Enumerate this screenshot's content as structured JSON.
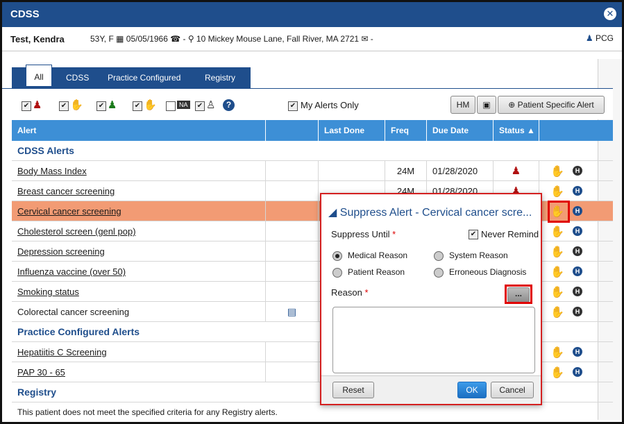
{
  "window": {
    "title": "CDSS",
    "close_glyph": "✕"
  },
  "patient": {
    "name": "Test, Kendra",
    "info": "53Y, F  ▦ 05/05/1966  ☎ -  ⚲ 10 Mickey Mouse Lane, Fall River, MA 2721  ✉ -",
    "pcg": "PCG"
  },
  "tabs": [
    {
      "label": "All",
      "active": true
    },
    {
      "label": "CDSS",
      "active": false
    },
    {
      "label": "Practice Configured",
      "active": false
    },
    {
      "label": "Registry",
      "active": false
    }
  ],
  "toolbar": {
    "my_alerts_only": "My Alerts Only",
    "hm_label": "HM",
    "patient_specific_alert": "Patient Specific Alert",
    "na_label": "NA"
  },
  "table": {
    "headers": [
      "Alert",
      "",
      "Last Done",
      "Freq",
      "Due Date",
      "Status ▲",
      ""
    ],
    "sections": {
      "cdss": "CDSS Alerts",
      "practice": "Practice Configured Alerts",
      "registry": "Registry"
    },
    "rows": [
      {
        "name": "Body Mass Index",
        "freq": "24M",
        "due": "01/28/2020",
        "status_icon": "person-alert-icon"
      },
      {
        "name": "Breast cancer screening",
        "freq": "24M",
        "due": "01/28/2020",
        "status_icon": "person-alert-icon"
      },
      {
        "name": "Cervical cancer screening"
      },
      {
        "name": "Cholesterol screen (genl pop)"
      },
      {
        "name": "Depression screening"
      },
      {
        "name": "Influenza vaccine (over 50)"
      },
      {
        "name": "Smoking status"
      },
      {
        "name": "Colorectal cancer screening"
      },
      {
        "name": "Hepatiitis C Screening"
      },
      {
        "name": "PAP 30 - 65"
      }
    ],
    "registry_message": "This patient does not meet the specified criteria for any Registry alerts."
  },
  "modal": {
    "title": "Suppress Alert - Cervical cancer scre...",
    "suppress_until": "Suppress Until",
    "never_remind": "Never Remind",
    "required_mark": "*",
    "radios": {
      "medical": "Medical Reason",
      "system": "System Reason",
      "patient": "Patient Reason",
      "erroneous": "Erroneous Diagnosis"
    },
    "reason": "Reason",
    "ellipsis": "...",
    "reset": "Reset",
    "ok": "OK",
    "cancel": "Cancel"
  },
  "colors": {
    "header_blue": "#1f4e8c",
    "table_header": "#3d8fd6",
    "highlight_row": "#f29b74",
    "red_highlight": "#e00000"
  }
}
